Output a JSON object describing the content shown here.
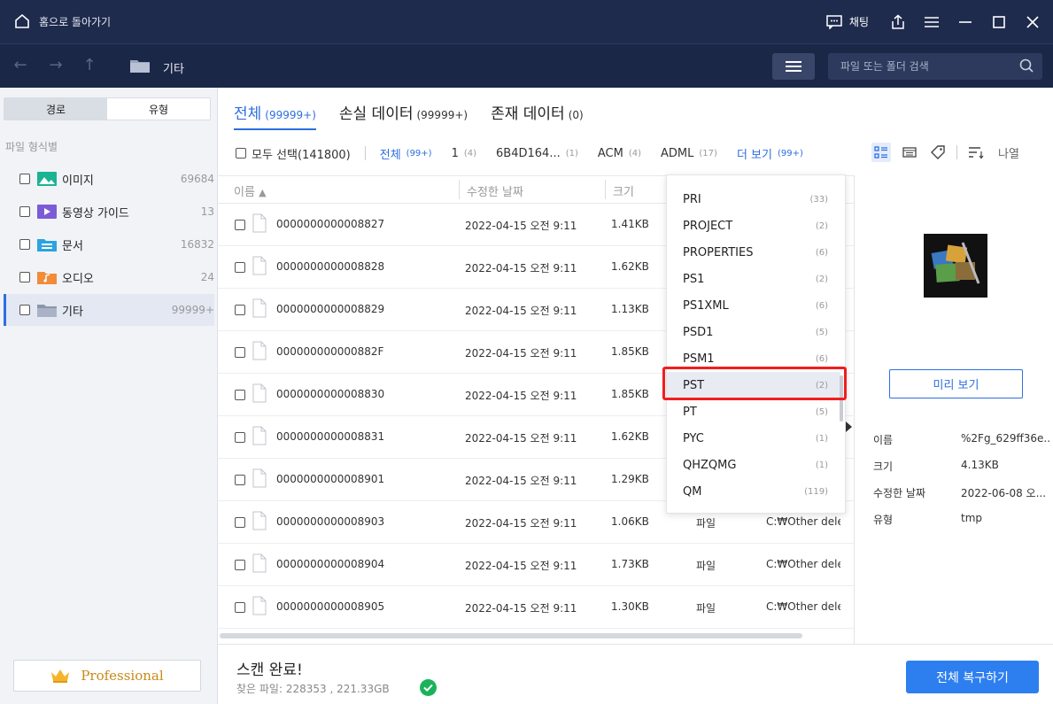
{
  "titlebar": {
    "home_label": "홈으로 돌아가기",
    "chat_label": "채팅"
  },
  "navbar": {
    "path": "기타",
    "search_placeholder": "파일 또는 폴더 검색"
  },
  "sidebar": {
    "segments": [
      "경로",
      "유형"
    ],
    "heading": "파일 형식별",
    "items": [
      {
        "label": "이미지",
        "count": "69684",
        "icon": "image-icon",
        "color": "#1ab394"
      },
      {
        "label": "동영상 가이드",
        "count": "13",
        "icon": "video-icon",
        "color": "#7b5cd6"
      },
      {
        "label": "문서",
        "count": "16832",
        "icon": "document-icon",
        "color": "#2aa3e0"
      },
      {
        "label": "오디오",
        "count": "24",
        "icon": "audio-icon",
        "color": "#f08c3a"
      },
      {
        "label": "기타",
        "count": "99999+",
        "icon": "other-folder-icon",
        "color": "#8b96ab"
      }
    ],
    "pro_label": "Professional"
  },
  "tabs": [
    {
      "label": "전체",
      "count": "(99999+)"
    },
    {
      "label": "손실 데이터",
      "count": "(99999+)"
    },
    {
      "label": "존재 데이터",
      "count": "(0)"
    }
  ],
  "filters": {
    "select_all": "모두 선택(141800)",
    "items": [
      {
        "label": "전체",
        "count": "(99+)"
      },
      {
        "label": "1",
        "count": "(4)"
      },
      {
        "label": "6B4D164...",
        "count": "(1)"
      },
      {
        "label": "ACM",
        "count": "(4)"
      },
      {
        "label": "ADML",
        "count": "(17)"
      },
      {
        "label": "더 보기",
        "count": "(99+)"
      }
    ],
    "sort_label": "나열"
  },
  "table": {
    "headers": {
      "name": "이름",
      "date": "수정한 날짜",
      "size": "크기"
    },
    "rows": [
      {
        "name": "0000000000008827",
        "date": "2022-04-15 오전 9:11",
        "size": "1.41KB",
        "type": "",
        "path": ""
      },
      {
        "name": "0000000000008828",
        "date": "2022-04-15 오전 9:11",
        "size": "1.62KB",
        "type": "",
        "path": ""
      },
      {
        "name": "0000000000008829",
        "date": "2022-04-15 오전 9:11",
        "size": "1.13KB",
        "type": "",
        "path": ""
      },
      {
        "name": "000000000000882F",
        "date": "2022-04-15 오전 9:11",
        "size": "1.85KB",
        "type": "",
        "path": ""
      },
      {
        "name": "0000000000008830",
        "date": "2022-04-15 오전 9:11",
        "size": "1.85KB",
        "type": "",
        "path": ""
      },
      {
        "name": "0000000000008831",
        "date": "2022-04-15 오전 9:11",
        "size": "1.62KB",
        "type": "",
        "path": ""
      },
      {
        "name": "0000000000008901",
        "date": "2022-04-15 오전 9:11",
        "size": "1.29KB",
        "type": "",
        "path": ""
      },
      {
        "name": "0000000000008903",
        "date": "2022-04-15 오전 9:11",
        "size": "1.06KB",
        "type": "파일",
        "path": "C:₩Other dele"
      },
      {
        "name": "0000000000008904",
        "date": "2022-04-15 오전 9:11",
        "size": "1.73KB",
        "type": "파일",
        "path": "C:₩Other dele"
      },
      {
        "name": "0000000000008905",
        "date": "2022-04-15 오전 9:11",
        "size": "1.30KB",
        "type": "파일",
        "path": "C:₩Other dele"
      }
    ]
  },
  "dropdown": {
    "items": [
      {
        "label": "PRI",
        "count": "(33)"
      },
      {
        "label": "PROJECT",
        "count": "(2)"
      },
      {
        "label": "PROPERTIES",
        "count": "(6)"
      },
      {
        "label": "PS1",
        "count": "(2)"
      },
      {
        "label": "PS1XML",
        "count": "(6)"
      },
      {
        "label": "PSD1",
        "count": "(5)"
      },
      {
        "label": "PSM1",
        "count": "(6)"
      },
      {
        "label": "PST",
        "count": "(2)"
      },
      {
        "label": "PT",
        "count": "(5)"
      },
      {
        "label": "PYC",
        "count": "(1)"
      },
      {
        "label": "QHZQMG",
        "count": "(1)"
      },
      {
        "label": "QM",
        "count": "(119)"
      }
    ],
    "highlighted": "PST"
  },
  "details": {
    "preview_label": "미리 보기",
    "props": [
      {
        "key": "이름",
        "value": "%2Fg_629ff36e..."
      },
      {
        "key": "크기",
        "value": "4.13KB"
      },
      {
        "key": "수정한 날짜",
        "value": "2022-06-08 오..."
      },
      {
        "key": "유형",
        "value": "tmp"
      }
    ]
  },
  "bottom": {
    "title": "스캔 완료!",
    "subtitle": "찾은 파일: 228353 , 221.33GB",
    "recover_label": "전체 복구하기"
  },
  "colors": {
    "titlebar_bg": "#1e2b4d",
    "accent": "#2d6fe0",
    "highlight_box": "#f21d1d",
    "success": "#1ab35b"
  }
}
